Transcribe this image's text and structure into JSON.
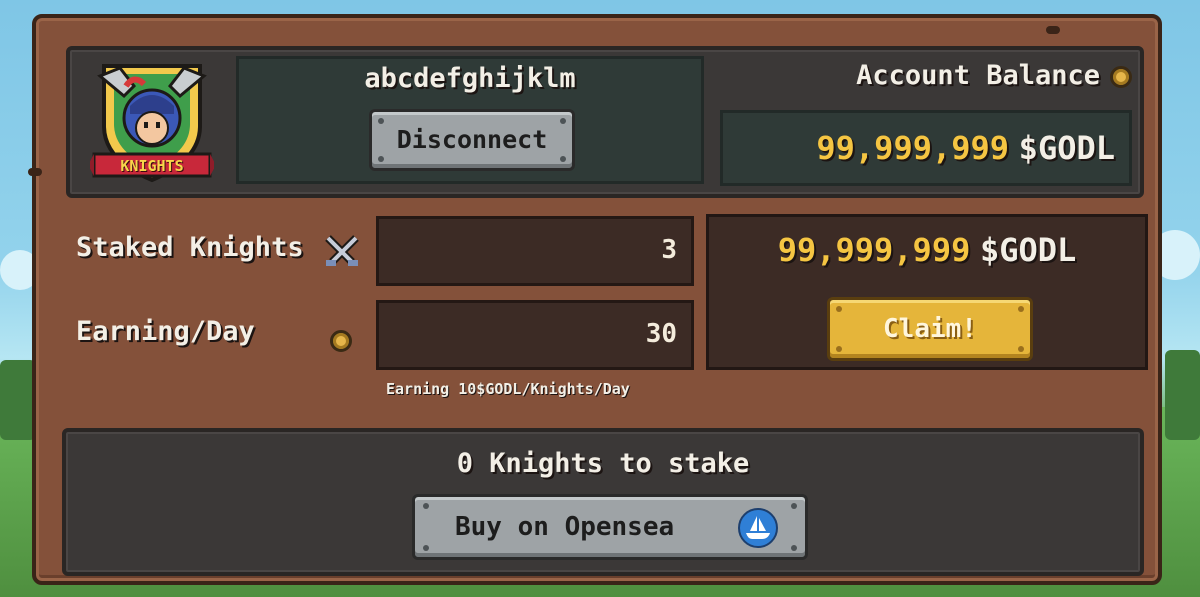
{
  "logo": {
    "banner_text": "KNIGHTS"
  },
  "wallet": {
    "address": "abcdefghijklm",
    "disconnect_label": "Disconnect"
  },
  "balance": {
    "label": "Account Balance",
    "amount": "99,999,999",
    "currency": "$GODL",
    "icon": "coin-icon"
  },
  "stats": {
    "staked_label": "Staked Knights",
    "staked_icon": "crossed-swords-icon",
    "staked_value": "3",
    "earning_label": "Earning/Day",
    "earning_icon": "coin-icon",
    "earning_value": "30",
    "earning_note": "Earning 10$GODL/Knights/Day"
  },
  "claim": {
    "amount": "99,999,999",
    "currency": "$GODL",
    "button_label": "Claim!"
  },
  "stake": {
    "count_text": "0 Knights to stake",
    "buy_label": "Buy on Opensea",
    "buy_icon": "opensea-icon"
  },
  "colors": {
    "board": "#84513a",
    "panel": "#3b3837",
    "gold_text": "#f5c542",
    "claim_button": "#e5b53a",
    "stone_button": "#9ea3a6",
    "opensea_blue": "#2f7fd6"
  }
}
